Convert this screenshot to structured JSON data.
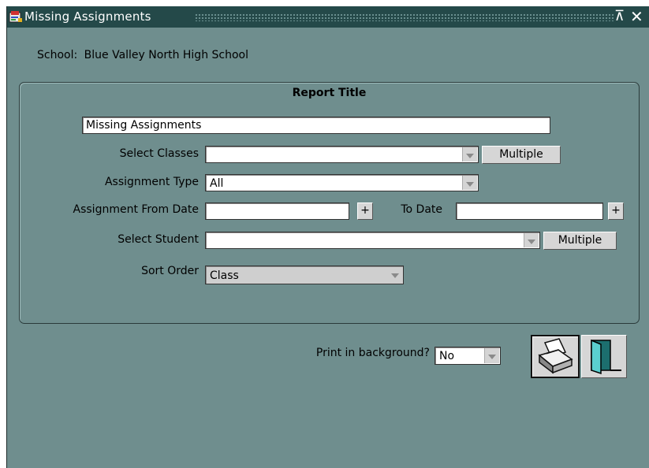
{
  "window": {
    "title": "Missing Assignments"
  },
  "school": {
    "label": "School:",
    "value": "Blue Valley North High School"
  },
  "report": {
    "frame_title": "Report Title",
    "title_value": "Missing Assignments"
  },
  "fields": {
    "select_classes": {
      "label": "Select Classes",
      "value": "",
      "button": "Multiple"
    },
    "assignment_type": {
      "label": "Assignment Type",
      "value": "All"
    },
    "from_date": {
      "label": "Assignment From Date",
      "value": "",
      "button": "+"
    },
    "to_date": {
      "label": "To Date",
      "value": "",
      "button": "+"
    },
    "select_student": {
      "label": "Select Student",
      "value": "",
      "button": "Multiple"
    },
    "sort_order": {
      "label": "Sort Order",
      "value": "Class"
    }
  },
  "print": {
    "label": "Print in background?",
    "value": "No"
  },
  "icons": {
    "app": "form-icon",
    "print": "printer-icon",
    "exit": "exit-door-icon",
    "restore": "restore-icon",
    "close": "close-icon"
  }
}
